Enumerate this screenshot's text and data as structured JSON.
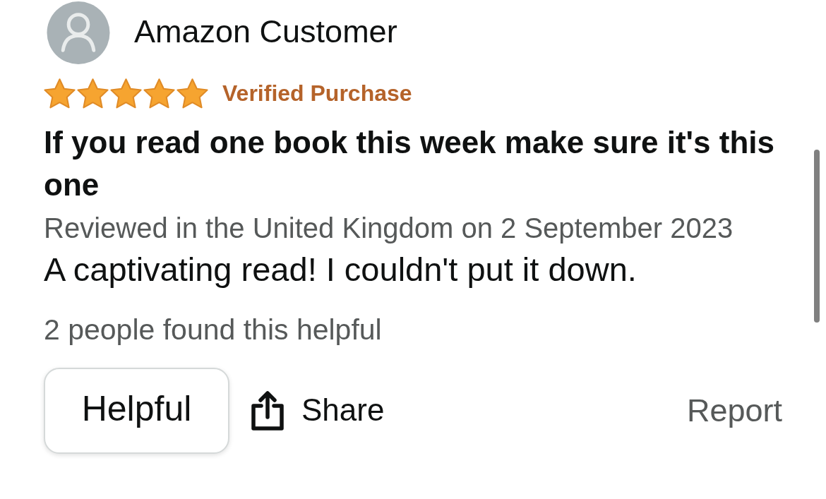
{
  "reviewer": {
    "name": "Amazon Customer"
  },
  "review": {
    "stars": 5,
    "badge": "Verified Purchase",
    "title": "If you read one book this week make sure it's this one",
    "meta": "Reviewed in the United Kingdom on 2 September 2023",
    "body": "A captivating read! I couldn't put it down.",
    "helpful_count": "2 people found this helpful"
  },
  "actions": {
    "helpful": "Helpful",
    "share": "Share",
    "report": "Report"
  }
}
